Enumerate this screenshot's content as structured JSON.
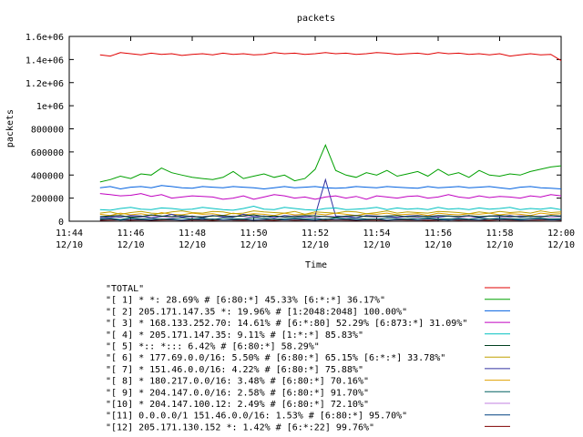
{
  "chart_data": {
    "type": "line",
    "title": "packets",
    "xlabel": "Time",
    "ylabel": "packets",
    "ylim": [
      0,
      1600000
    ],
    "yticks": [
      {
        "value": 0,
        "label": "0"
      },
      {
        "value": 200000,
        "label": "200000"
      },
      {
        "value": 400000,
        "label": "400000"
      },
      {
        "value": 600000,
        "label": "600000"
      },
      {
        "value": 800000,
        "label": "800000"
      },
      {
        "value": 1000000,
        "label": "1e+06"
      },
      {
        "value": 1200000,
        "label": "1.2e+06"
      },
      {
        "value": 1400000,
        "label": "1.4e+06"
      },
      {
        "value": 1600000,
        "label": "1.6e+06"
      }
    ],
    "xlim": [
      "11:44",
      "12:00"
    ],
    "xticks": [
      {
        "time": "11:44",
        "date": "12/10"
      },
      {
        "time": "11:46",
        "date": "12/10"
      },
      {
        "time": "11:48",
        "date": "12/10"
      },
      {
        "time": "11:50",
        "date": "12/10"
      },
      {
        "time": "11:52",
        "date": "12/10"
      },
      {
        "time": "11:54",
        "date": "12/10"
      },
      {
        "time": "11:56",
        "date": "12/10"
      },
      {
        "time": "11:58",
        "date": "12/10"
      },
      {
        "time": "12:00",
        "date": "12/10"
      }
    ],
    "legend_position": "bottom",
    "x": [
      "11:45:00",
      "11:45:20",
      "11:45:40",
      "11:46:00",
      "11:46:20",
      "11:46:40",
      "11:47:00",
      "11:47:20",
      "11:47:40",
      "11:48:00",
      "11:48:20",
      "11:48:40",
      "11:49:00",
      "11:49:20",
      "11:49:40",
      "11:50:00",
      "11:50:20",
      "11:50:40",
      "11:51:00",
      "11:51:20",
      "11:51:40",
      "11:52:00",
      "11:52:20",
      "11:52:40",
      "11:53:00",
      "11:53:20",
      "11:53:40",
      "11:54:00",
      "11:54:20",
      "11:54:40",
      "11:55:00",
      "11:55:20",
      "11:55:40",
      "11:56:00",
      "11:56:20",
      "11:56:40",
      "11:57:00",
      "11:57:20",
      "11:57:40",
      "11:58:00",
      "11:58:20",
      "11:58:40",
      "11:59:00",
      "11:59:20",
      "11:59:40",
      "12:00:00"
    ],
    "series": [
      {
        "name": "\"TOTAL\"",
        "color": "#e00000",
        "values": [
          1440000,
          1430000,
          1460000,
          1450000,
          1440000,
          1455000,
          1445000,
          1450000,
          1435000,
          1445000,
          1450000,
          1440000,
          1455000,
          1445000,
          1450000,
          1440000,
          1445000,
          1460000,
          1450000,
          1455000,
          1445000,
          1450000,
          1460000,
          1450000,
          1455000,
          1445000,
          1450000,
          1460000,
          1455000,
          1445000,
          1450000,
          1455000,
          1445000,
          1460000,
          1450000,
          1455000,
          1445000,
          1450000,
          1440000,
          1450000,
          1430000,
          1440000,
          1450000,
          1440000,
          1445000,
          1390000
        ]
      },
      {
        "name": "\"[ 1] * *: 28.69% # [6:80:*] 45.33% [6:*:*] 36.17%\"",
        "color": "#00a000",
        "values": [
          340000,
          360000,
          390000,
          370000,
          410000,
          400000,
          460000,
          420000,
          400000,
          380000,
          370000,
          360000,
          380000,
          430000,
          370000,
          390000,
          410000,
          380000,
          400000,
          350000,
          370000,
          450000,
          660000,
          440000,
          400000,
          380000,
          420000,
          400000,
          440000,
          390000,
          410000,
          430000,
          390000,
          450000,
          400000,
          420000,
          380000,
          440000,
          400000,
          390000,
          410000,
          400000,
          430000,
          450000,
          470000,
          480000
        ]
      },
      {
        "name": "\"[ 2] 205.171.147.35 *: 19.96% # [1:2048:2048] 100.00%\"",
        "color": "#0060e0",
        "values": [
          290000,
          300000,
          280000,
          295000,
          300000,
          290000,
          310000,
          300000,
          290000,
          285000,
          300000,
          295000,
          290000,
          300000,
          295000,
          290000,
          280000,
          290000,
          300000,
          290000,
          295000,
          300000,
          290000,
          285000,
          290000,
          300000,
          295000,
          290000,
          300000,
          295000,
          290000,
          285000,
          300000,
          290000,
          295000,
          300000,
          290000,
          295000,
          300000,
          290000,
          280000,
          295000,
          300000,
          290000,
          285000,
          280000
        ]
      },
      {
        "name": "\"[ 3] * 168.133.252.70: 14.61% # [6:*:80] 52.29% [6:873:*] 31.09%\"",
        "color": "#c000c0",
        "values": [
          240000,
          230000,
          220000,
          225000,
          240000,
          215000,
          230000,
          200000,
          210000,
          220000,
          215000,
          210000,
          190000,
          200000,
          220000,
          190000,
          210000,
          230000,
          220000,
          200000,
          210000,
          190000,
          210000,
          220000,
          200000,
          215000,
          190000,
          220000,
          210000,
          200000,
          215000,
          220000,
          200000,
          210000,
          230000,
          210000,
          200000,
          220000,
          205000,
          215000,
          210000,
          200000,
          220000,
          210000,
          230000,
          220000
        ]
      },
      {
        "name": "\"[ 4] * 205.171.147.35: 9.11% # [1:*:*] 85.83%\"",
        "color": "#00c0c0",
        "values": [
          100000,
          95000,
          110000,
          120000,
          105000,
          100000,
          115000,
          110000,
          100000,
          105000,
          120000,
          110000,
          100000,
          95000,
          110000,
          130000,
          105000,
          100000,
          120000,
          110000,
          100000,
          95000,
          110000,
          115000,
          100000,
          105000,
          110000,
          120000,
          100000,
          115000,
          105000,
          110000,
          100000,
          120000,
          105000,
          110000,
          100000,
          115000,
          105000,
          110000,
          120000,
          100000,
          110000,
          105000,
          115000,
          100000
        ]
      },
      {
        "name": "\"[ 5] *:: *::: 6.42% # [6:80:*] 58.29%\"",
        "color": "#004020",
        "values": [
          40000,
          45000,
          50000,
          35000,
          40000,
          55000,
          45000,
          40000,
          50000,
          42000,
          38000,
          45000,
          50000,
          40000,
          45000,
          55000,
          40000,
          45000,
          38000,
          42000,
          50000,
          45000,
          40000,
          35000,
          45000,
          50000,
          42000,
          40000,
          45000,
          50000,
          38000,
          45000,
          40000,
          50000,
          45000,
          42000,
          48000,
          40000,
          45000,
          50000,
          42000,
          40000,
          45000,
          38000,
          50000,
          45000
        ]
      },
      {
        "name": "\"[ 6] * 177.69.0.0/16: 5.50% # [6:80:*] 65.15% [6:*:*] 33.78%\"",
        "color": "#c0a000",
        "values": [
          70000,
          80000,
          60000,
          75000,
          85000,
          70000,
          65000,
          80000,
          90000,
          75000,
          70000,
          85000,
          80000,
          65000,
          70000,
          90000,
          80000,
          75000,
          70000,
          85000,
          60000,
          80000,
          75000,
          70000,
          85000,
          80000,
          65000,
          75000,
          90000,
          70000,
          80000,
          75000,
          70000,
          85000,
          80000,
          75000,
          65000,
          80000,
          70000,
          85000,
          75000,
          80000,
          70000,
          90000,
          75000,
          80000
        ]
      },
      {
        "name": "\"[ 7] * 151.46.0.0/16: 4.22% # [6:80:*] 75.88%\"",
        "color": "#3030a0",
        "values": [
          30000,
          40000,
          35000,
          50000,
          45000,
          30000,
          40000,
          60000,
          35000,
          45000,
          30000,
          50000,
          40000,
          35000,
          60000,
          40000,
          45000,
          30000,
          50000,
          40000,
          35000,
          50000,
          360000,
          45000,
          40000,
          30000,
          50000,
          45000,
          40000,
          35000,
          45000,
          50000,
          40000,
          35000,
          45000,
          40000,
          50000,
          35000,
          45000,
          40000,
          50000,
          35000,
          45000,
          40000,
          50000,
          40000
        ]
      },
      {
        "name": "\"[ 8] * 180.217.0.0/16: 3.48% # [6:80:*] 70.16%\"",
        "color": "#e0a000",
        "values": [
          60000,
          50000,
          70000,
          55000,
          65000,
          50000,
          75000,
          60000,
          55000,
          70000,
          60000,
          65000,
          50000,
          70000,
          55000,
          65000,
          60000,
          50000,
          70000,
          55000,
          60000,
          65000,
          55000,
          70000,
          60000,
          50000,
          65000,
          60000,
          70000,
          55000,
          60000,
          65000,
          50000,
          70000,
          60000,
          55000,
          65000,
          60000,
          70000,
          55000,
          65000,
          60000,
          50000,
          70000,
          60000,
          65000
        ]
      },
      {
        "name": "\"[ 9] * 204.147.0.0/16: 2.58% # [6:80:*] 91.70%\"",
        "color": "#006060",
        "values": [
          20000,
          25000,
          15000,
          30000,
          20000,
          25000,
          18000,
          22000,
          30000,
          20000,
          25000,
          15000,
          28000,
          22000,
          20000,
          30000,
          25000,
          18000,
          22000,
          28000,
          20000,
          25000,
          15000,
          30000,
          22000,
          25000,
          20000,
          18000,
          28000,
          22000,
          20000,
          25000,
          30000,
          20000,
          22000,
          25000,
          18000,
          28000,
          20000,
          25000,
          22000,
          20000,
          28000,
          25000,
          20000,
          22000
        ]
      },
      {
        "name": "\"[10] * 204.147.100.12: 2.49% # [6:80:*] 72.10%\"",
        "color": "#c080e0",
        "values": [
          35000,
          30000,
          45000,
          40000,
          35000,
          50000,
          40000,
          30000,
          45000,
          35000,
          40000,
          50000,
          35000,
          45000,
          40000,
          30000,
          45000,
          40000,
          35000,
          50000,
          40000,
          30000,
          45000,
          40000,
          35000,
          50000,
          40000,
          35000,
          45000,
          30000,
          40000,
          35000,
          50000,
          40000,
          45000,
          35000,
          40000,
          30000,
          45000,
          40000,
          35000,
          50000,
          40000,
          45000,
          35000,
          40000
        ]
      },
      {
        "name": "\"[11] 0.0.0.0/1 151.46.0.0/16: 1.53% # [6:80:*] 95.70%\"",
        "color": "#004080",
        "values": [
          15000,
          20000,
          10000,
          18000,
          15000,
          12000,
          20000,
          15000,
          10000,
          18000,
          15000,
          20000,
          12000,
          15000,
          18000,
          10000,
          15000,
          20000,
          12000,
          18000,
          15000,
          10000,
          20000,
          15000,
          18000,
          12000,
          15000,
          20000,
          10000,
          15000,
          18000,
          12000,
          20000,
          15000,
          10000,
          18000,
          15000,
          12000,
          20000,
          15000,
          18000,
          10000,
          15000,
          20000,
          12000,
          15000
        ]
      },
      {
        "name": "\"[12] 205.171.130.152 *: 1.42% # [6:*:22] 99.76%\"",
        "color": "#800000",
        "values": [
          8000,
          10000,
          12000,
          9000,
          11000,
          8000,
          10000,
          12000,
          9000,
          10000,
          11000,
          8000,
          12000,
          10000,
          9000,
          11000,
          10000,
          8000,
          12000,
          9000,
          10000,
          11000,
          9000,
          12000,
          10000,
          8000,
          11000,
          10000,
          9000,
          12000,
          10000,
          11000,
          8000,
          10000,
          12000,
          9000,
          11000,
          10000,
          8000,
          12000,
          10000,
          9000,
          11000,
          10000,
          12000,
          9000
        ]
      }
    ]
  }
}
